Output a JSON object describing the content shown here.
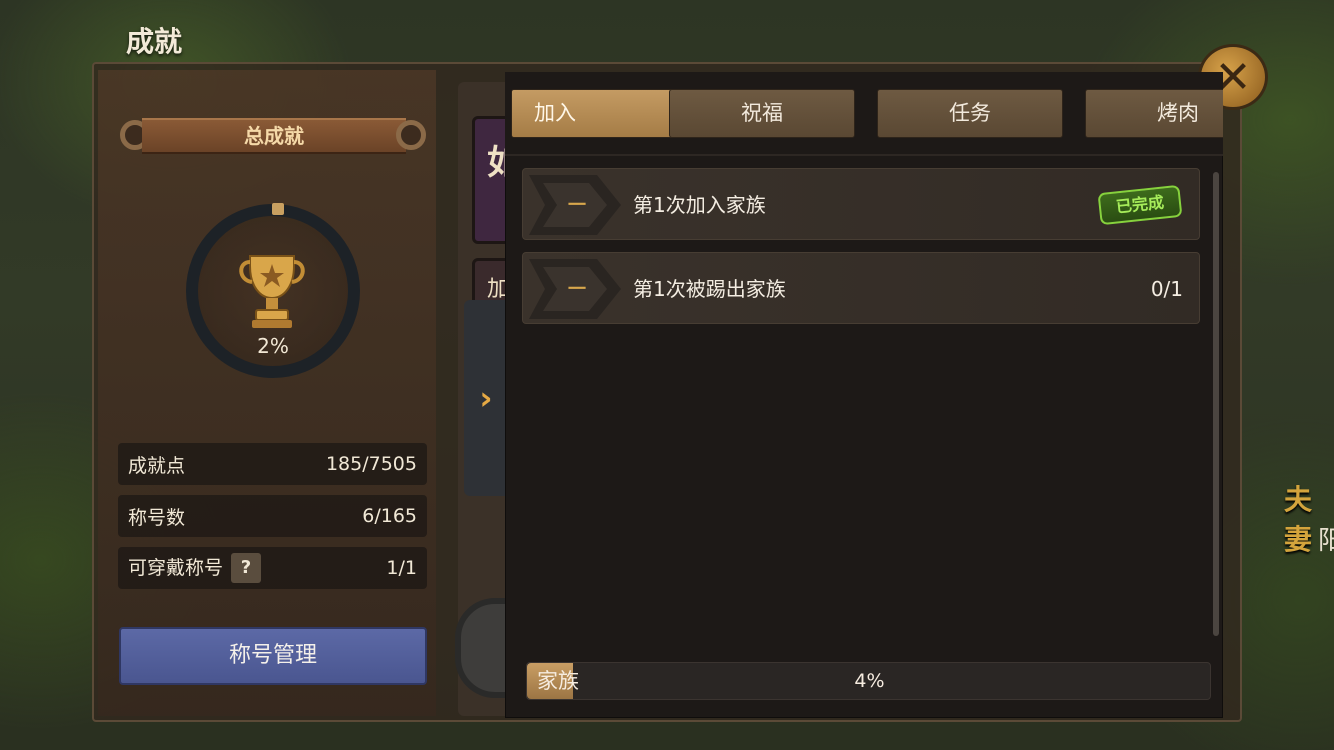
{
  "window": {
    "title": "成就"
  },
  "summary": {
    "banner": "总成就",
    "percent": "2%",
    "percent_value": 0.02,
    "stats": [
      {
        "label": "成就点",
        "value": "185/7505"
      },
      {
        "label": "称号数",
        "value": "6/165"
      },
      {
        "label": "可穿戴称号",
        "value": "1/1",
        "help": "?"
      }
    ],
    "title_manage_button": "称号管理"
  },
  "middle": {
    "card1_glyph": "如",
    "card2_glyph": "加"
  },
  "tabs": [
    {
      "label": "加入",
      "active": true
    },
    {
      "label": "祝福",
      "active": false
    },
    {
      "label": "任务",
      "active": false
    },
    {
      "label": "烤肉",
      "active": false
    }
  ],
  "achievements": [
    {
      "emblem": "一",
      "name": "第1次加入家族",
      "status": "已完成",
      "completed": true
    },
    {
      "emblem": "一",
      "name": "第1次被踢出家族",
      "progress": "0/1",
      "completed": false
    }
  ],
  "category": {
    "name": "家族",
    "percent": "4%",
    "progress_value": 0.04
  },
  "background_text": {
    "line1": "夫妻",
    "line2": "阳"
  },
  "colors": {
    "accent_gold": "#c49b63",
    "manage_button_blue": "#5c69a6",
    "done_green": "#86d23d",
    "panel_dark": "#1d1917"
  }
}
